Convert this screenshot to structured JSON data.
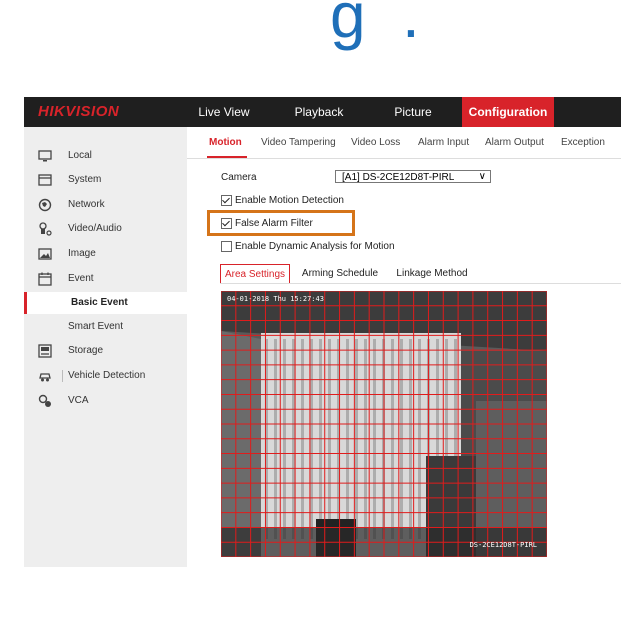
{
  "app": {
    "logo": {
      "brand_red": "HIK",
      "brand_rest": "VISION"
    },
    "colors": {
      "accent": "#d8232a",
      "highlight": "#d57419",
      "navbar": "#1f1f1f"
    }
  },
  "navbar": {
    "items": [
      {
        "label": "Live View"
      },
      {
        "label": "Playback"
      },
      {
        "label": "Picture"
      },
      {
        "label": "Configuration",
        "active": true
      }
    ]
  },
  "sidebar": {
    "items": [
      {
        "label": "Local",
        "icon": "monitor-icon"
      },
      {
        "label": "System",
        "icon": "system-icon"
      },
      {
        "label": "Network",
        "icon": "network-icon"
      },
      {
        "label": "Video/Audio",
        "icon": "video-audio-icon"
      },
      {
        "label": "Image",
        "icon": "image-icon"
      },
      {
        "label": "Event",
        "icon": "event-icon"
      },
      {
        "label": "Basic Event",
        "sub": true,
        "active": true
      },
      {
        "label": "Smart Event",
        "sub": true
      },
      {
        "label": "Storage",
        "icon": "storage-icon"
      },
      {
        "label": "Vehicle Detection",
        "icon": "vehicle-icon"
      },
      {
        "label": "VCA",
        "icon": "vca-icon"
      }
    ]
  },
  "tabs": [
    {
      "label": "Motion",
      "active": true
    },
    {
      "label": "Video Tampering"
    },
    {
      "label": "Video Loss"
    },
    {
      "label": "Alarm Input"
    },
    {
      "label": "Alarm Output"
    },
    {
      "label": "Exception"
    }
  ],
  "form": {
    "camera_label": "Camera",
    "camera_value": "[A1] DS-2CE12D8T-PIRL",
    "enable_motion": {
      "label": "Enable Motion Detection",
      "checked": true
    },
    "false_alarm": {
      "label": "False Alarm Filter",
      "checked": true
    },
    "dynamic_analysis": {
      "label": "Enable Dynamic Analysis for Motion",
      "checked": false
    }
  },
  "subtabs": [
    {
      "label": "Area Settings",
      "active": true
    },
    {
      "label": "Arming Schedule"
    },
    {
      "label": "Linkage Method"
    }
  ],
  "video": {
    "osd_time": "04-01-2018 Thu 15:27:43",
    "osd_camera": "DS-2CE12D8T-PIRL",
    "grid_color": "#e01c1c"
  }
}
